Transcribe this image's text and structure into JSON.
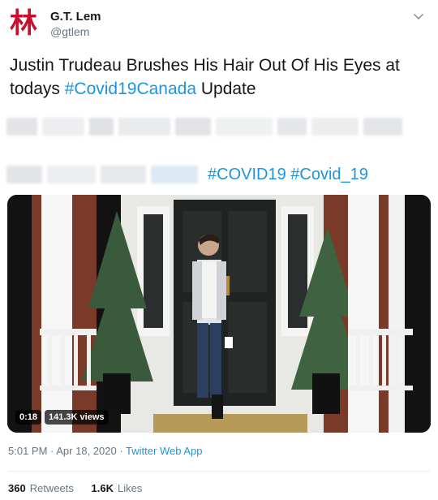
{
  "author": {
    "avatar_glyph": "林",
    "display_name": "G.T. Lem",
    "handle": "@gtlem"
  },
  "menu": {
    "icon": "chevron-down-icon"
  },
  "tweet": {
    "text_before": "Justin Trudeau Brushes His Hair Out Of His Eyes at todays ",
    "hashtag": "#Covid19Canada",
    "text_after": " Update"
  },
  "quoted_line": {
    "hashtag_1": "#COVID19",
    "hashtag_2": "#Covid_19"
  },
  "media": {
    "duration": "0:18",
    "views": "141.3K views"
  },
  "meta": {
    "time": "5:01 PM",
    "separator_1": " · ",
    "date": "Apr 18, 2020",
    "separator_2": " · ",
    "source": "Twitter Web App"
  },
  "stats": {
    "retweets_count": "360",
    "retweets_label": "Retweets",
    "likes_count": "1.6K",
    "likes_label": "Likes"
  },
  "colors": {
    "link": "#1b95e0",
    "muted": "#657786",
    "text": "#14171a",
    "avatar": "#c8102e"
  }
}
